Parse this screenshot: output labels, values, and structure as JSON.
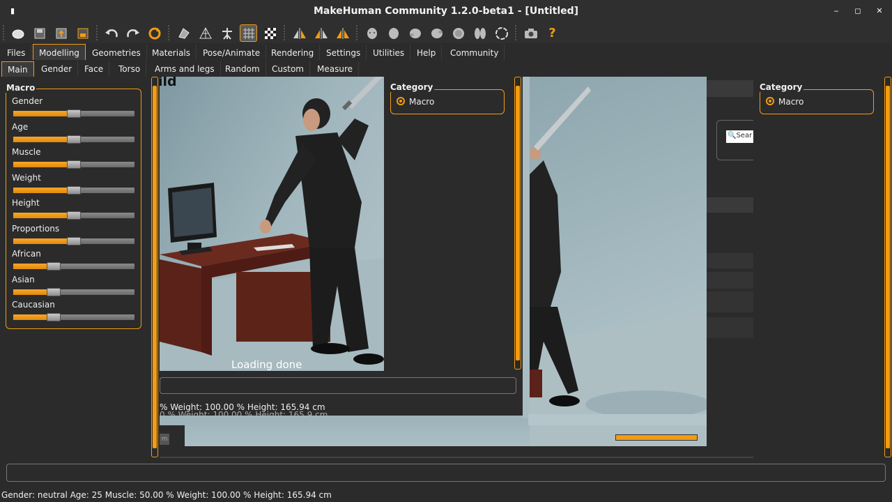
{
  "window": {
    "title": "MakeHuman Community 1.2.0-beta1 - [Untitled]",
    "minimize": "‒",
    "maximize": "◻",
    "close": "✕",
    "menu_glyph": "▮"
  },
  "main_tabs": [
    "Files",
    "Modelling",
    "Geometries",
    "Materials",
    "Pose/Animate",
    "Rendering",
    "Settings",
    "Utilities",
    "Help",
    "Community"
  ],
  "sub_tabs": [
    "Main",
    "Gender",
    "Face",
    "Torso",
    "Arms and legs",
    "Random",
    "Custom",
    "Measure"
  ],
  "macro": {
    "title": "Macro",
    "sliders": [
      {
        "label": "Gender",
        "value": 0.5
      },
      {
        "label": "Age",
        "value": 0.5
      },
      {
        "label": "Muscle",
        "value": 0.5
      },
      {
        "label": "Weight",
        "value": 0.5
      },
      {
        "label": "Height",
        "value": 0.5
      },
      {
        "label": "Proportions",
        "value": 0.5
      },
      {
        "label": "African",
        "value": 0.333
      },
      {
        "label": "Asian",
        "value": 0.333
      },
      {
        "label": "Caucasian",
        "value": 0.333
      }
    ]
  },
  "category": {
    "title": "Category",
    "option": "Macro"
  },
  "viewport": {
    "loading": "Loading done",
    "corner_text": "ild",
    "overlay_status": "% Weight: 100.00 % Height: 165.94 cm",
    "overlay_status_ghost": "0 % Weight: 100.00 % Height: 165.9 cm",
    "search_placeholder": "Sear",
    "mini_btn": "m"
  },
  "status": {
    "text": "Gender: neutral  Age: 25  Muscle: 50.00 %  Weight: 100.00 %  Height: 165.94 cm"
  },
  "colors": {
    "accent": "#f39c12",
    "background": "#2b2b2b"
  }
}
